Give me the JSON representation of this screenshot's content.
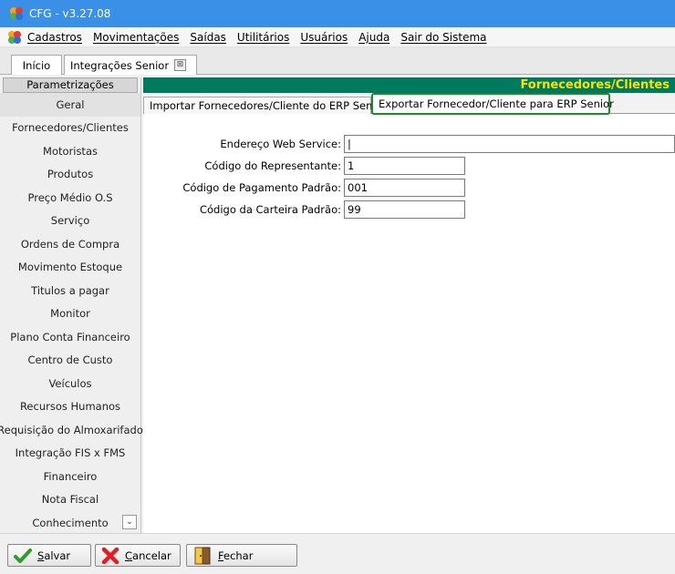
{
  "window": {
    "title": "CFG - v3.27.08"
  },
  "menu": [
    "Cadastros",
    "Movimentações",
    "Saídas",
    "Utilitários",
    "Usuários",
    "Ajuda",
    "Sair do Sistema"
  ],
  "tabs": {
    "inicio": "Início",
    "integracoes": "Integrações Senior",
    "close_glyph": "⊠"
  },
  "sidebar": {
    "header": "Parametrizações",
    "items": [
      "Geral",
      "Fornecedores/Clientes",
      "Motoristas",
      "Produtos",
      "Preço Médio O.S",
      "Serviço",
      "Ordens de Compra",
      "Movimento Estoque",
      "Titulos a pagar",
      "Monitor",
      "Plano Conta Financeiro",
      "Centro de Custo",
      "Veículos",
      "Recursos Humanos",
      "Requisição do Almoxarifado",
      "Integração FIS x FMS",
      "Financeiro",
      "Nota Fiscal",
      "Conhecimento"
    ],
    "scroll_glyph": "⌄"
  },
  "main": {
    "banner": "Fornecedores/Clientes",
    "subtabs": {
      "import": "Importar Fornecedores/Cliente do ERP Senior",
      "export": "Exportar Fornecedor/Cliente para ERP Senior"
    },
    "form": {
      "web_service": {
        "label": "Endereço Web Service:",
        "value": "|"
      },
      "representante": {
        "label": "Código do Representante:",
        "value": "1"
      },
      "pagamento": {
        "label": "Código de Pagamento Padrão:",
        "value": "001"
      },
      "carteira": {
        "label": "Código da Carteira Padrão:",
        "value": "99"
      }
    }
  },
  "footer": {
    "salvar": {
      "first": "S",
      "rest": "alvar"
    },
    "cancelar": {
      "first": "C",
      "rest": "ancelar"
    },
    "fechar": {
      "first": "F",
      "rest": "echar"
    }
  },
  "colors": {
    "titlebar": "#3a8fe6",
    "banner_bg": "#007a5e",
    "banner_text": "#ffe100",
    "active_tab_border": "#1e8a2e"
  }
}
